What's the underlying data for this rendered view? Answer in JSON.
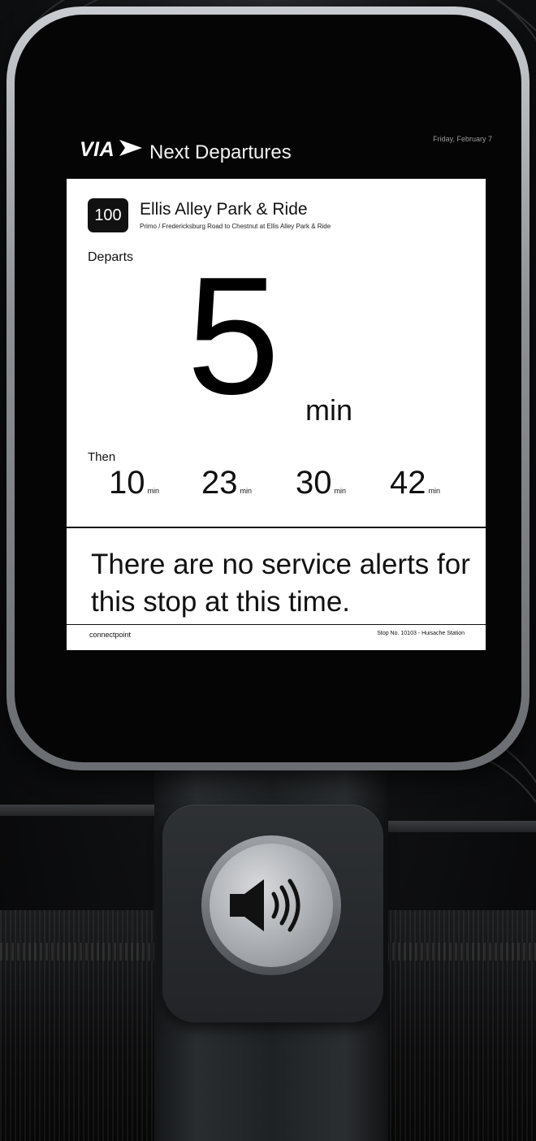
{
  "header": {
    "logo_text": "VIA",
    "title": "Next Departures",
    "date": "Friday, February 7"
  },
  "route": {
    "number": "100",
    "name": "Ellis Alley Park & Ride",
    "subtitle": "Primo / Fredericksburg Road to Chestnut at Ellis Alley Park & Ride"
  },
  "departure": {
    "label": "Departs",
    "minutes": "5",
    "unit": "min"
  },
  "then": {
    "label": "Then",
    "times": [
      {
        "value": "10",
        "unit": "min"
      },
      {
        "value": "23",
        "unit": "min"
      },
      {
        "value": "30",
        "unit": "min"
      },
      {
        "value": "42",
        "unit": "min"
      }
    ]
  },
  "alerts": {
    "message": "There are no service alerts for this stop at this time."
  },
  "footer": {
    "brand": "connectpoint",
    "stop_info": "Stop No. 10103 - Huisache Station"
  },
  "hardware": {
    "audio_button_icon": "speaker-icon"
  },
  "colors": {
    "screen_background": "#050505",
    "panel_background": "#ffffff",
    "text": "#111111",
    "badge": "#111111"
  }
}
